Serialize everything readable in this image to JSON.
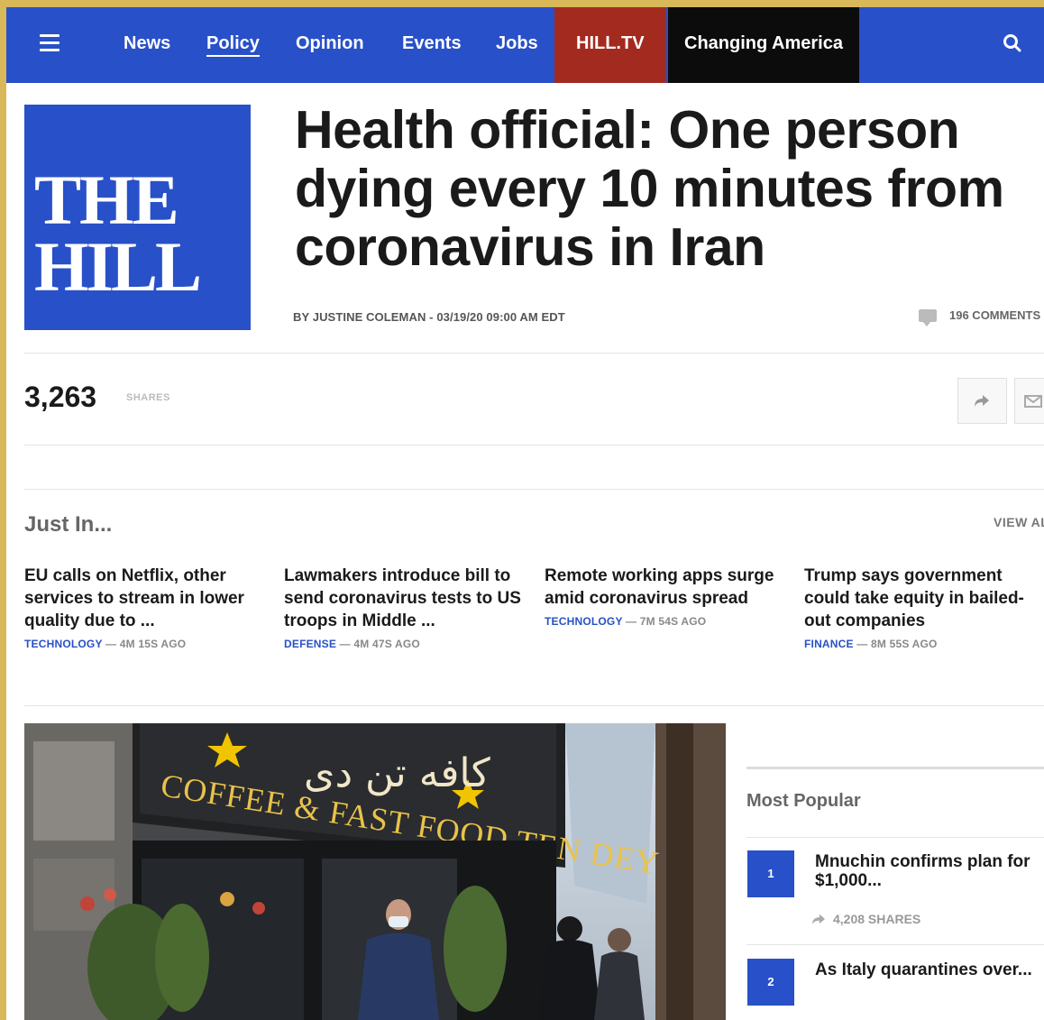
{
  "nav": {
    "items": [
      "News",
      "Policy",
      "Opinion",
      "Events",
      "Jobs"
    ],
    "hilltv": "HILL.TV",
    "changing": "Changing America",
    "brand_color": "#2850c8"
  },
  "logo": {
    "line1": "THE",
    "line2": "HILL"
  },
  "article": {
    "headline": "Health official: One person dying every 10 minutes from coronavirus in Iran",
    "byline": "BY JUSTINE COLEMAN - 03/19/20 09:00 AM EDT",
    "comments": "196 COMMENTS",
    "shares_count": "3,263",
    "shares_label": "SHARES"
  },
  "just_in": {
    "title": "Just In...",
    "view_all": "VIEW ALL",
    "stories": [
      {
        "title": "EU calls on Netflix, other services to stream in lower quality due to ...",
        "category": "TECHNOLOGY",
        "time": "— 4M 15S AGO"
      },
      {
        "title": "Lawmakers introduce bill to send coronavirus tests to US troops in Middle ...",
        "category": "DEFENSE",
        "time": "— 4M 47S AGO"
      },
      {
        "title": "Remote working apps surge amid coronavirus spread",
        "category": "TECHNOLOGY",
        "time": "— 7M 54S AGO"
      },
      {
        "title": "Trump says government could take equity in bailed-out companies",
        "category": "FINANCE",
        "time": "— 8M 55S AGO"
      }
    ]
  },
  "photo": {
    "sign": "COFFEE & FAST FOOD TEN DEY",
    "sign_farsi": "کافه تن دی"
  },
  "most_popular": {
    "title": "Most Popular",
    "items": [
      {
        "rank": "1",
        "title": "Mnuchin confirms plan for $1,000...",
        "shares": "4,208 SHARES"
      },
      {
        "rank": "2",
        "title": "As Italy quarantines over..."
      }
    ]
  }
}
